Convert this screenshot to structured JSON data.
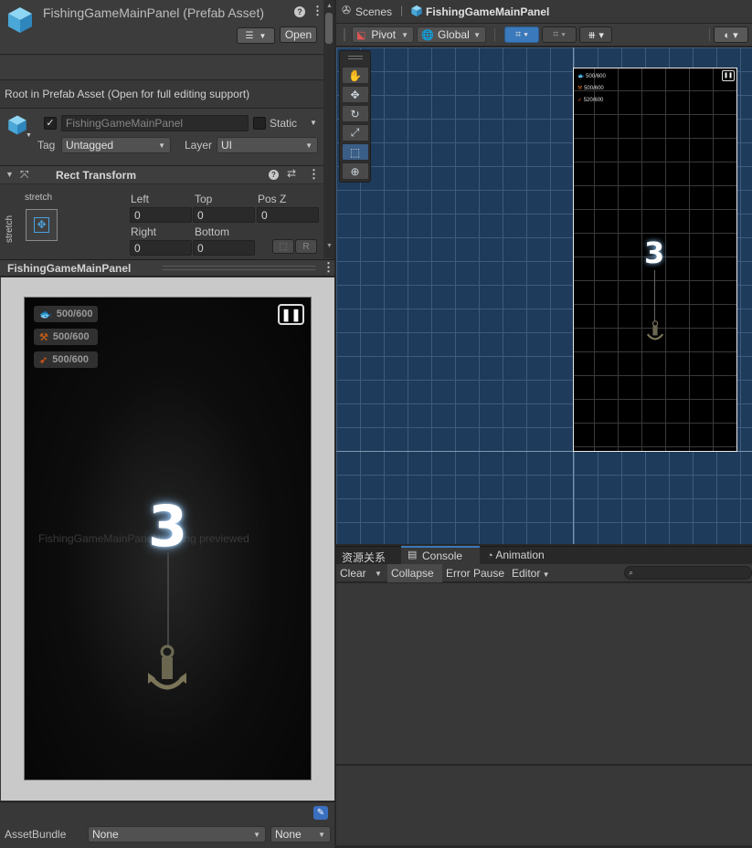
{
  "inspector": {
    "title": "FishingGameMainPanel (Prefab Asset)",
    "open_label": "Open",
    "root_notice": "Root in Prefab Asset (Open for full editing support)",
    "object_name": "FishingGameMainPanel",
    "static_label": "Static",
    "tag_label": "Tag",
    "tag_value": "Untagged",
    "layer_label": "Layer",
    "layer_value": "UI",
    "rect_header": "Rect Transform",
    "anchor_h": "stretch",
    "anchor_v": "stretch",
    "left_label": "Left",
    "left_value": "0",
    "top_label": "Top",
    "top_value": "0",
    "posz_label": "Pos Z",
    "posz_value": "0",
    "right_label": "Right",
    "right_value": "0",
    "bottom_label": "Bottom",
    "bottom_value": "0",
    "r_label": "R"
  },
  "preview": {
    "header": "FishingGameMainPanel",
    "stats": [
      "500/600",
      "500/600",
      "500/600"
    ],
    "countdown": "3",
    "overlay_text": "FishingGameMainPanel is being previewed"
  },
  "assetbundle": {
    "label": "AssetBundle",
    "name_value": "None",
    "variant_value": "None"
  },
  "scene": {
    "tab_scenes": "Scenes",
    "tab_prefab": "FishingGameMainPanel",
    "pivot_label": "Pivot",
    "global_label": "Global",
    "stats": [
      "500/600",
      "500/600",
      "520/600"
    ],
    "countdown": "3"
  },
  "console": {
    "tab_assets": "资源关系",
    "tab_console": "Console",
    "tab_animation": "Animation",
    "clear_label": "Clear",
    "collapse_label": "Collapse",
    "error_pause_label": "Error Pause",
    "editor_label": "Editor",
    "search_placeholder": ""
  },
  "colors": {
    "accent": "#3a79bb",
    "prefab_icon": "#5cb8e6",
    "scene_bg": "#1f3b5b"
  }
}
